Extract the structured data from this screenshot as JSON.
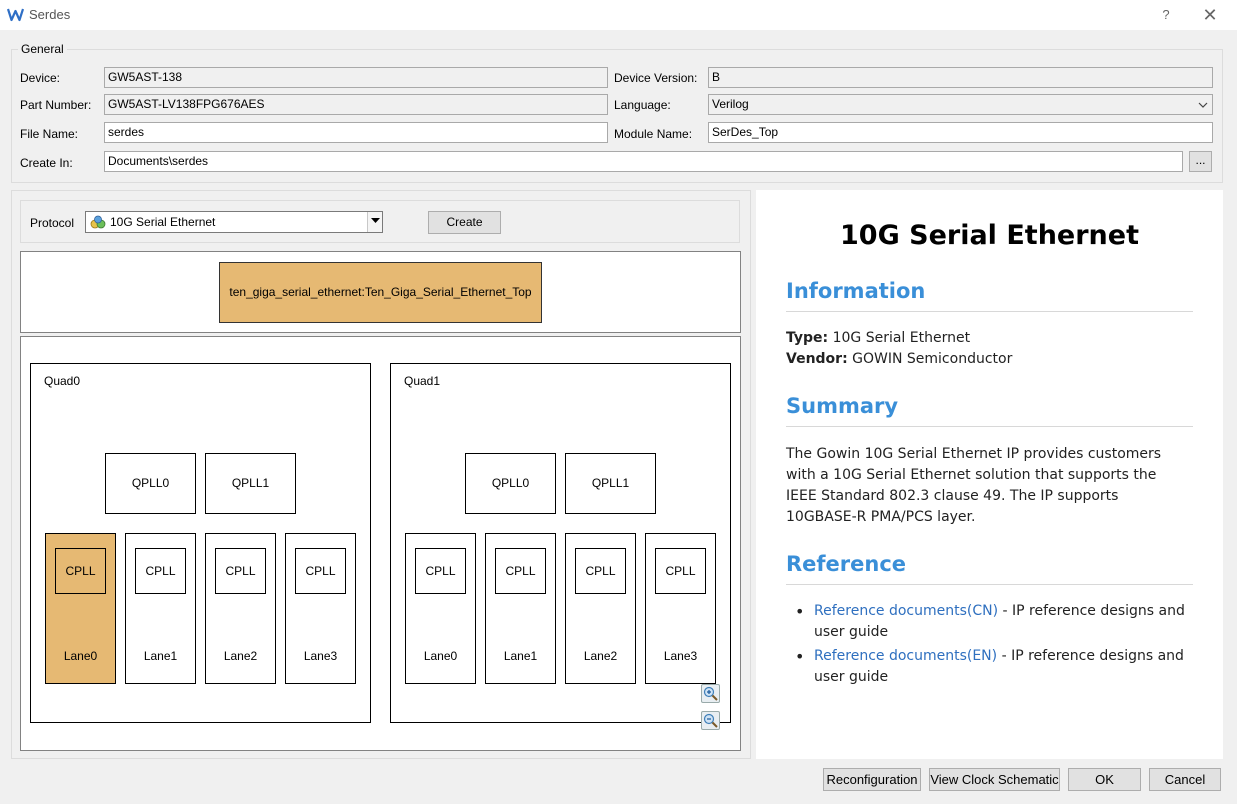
{
  "window": {
    "title": "Serdes",
    "help": "?",
    "close": "✕"
  },
  "general": {
    "group_title": "General",
    "device_label": "Device:",
    "device_value": "GW5AST-138",
    "device_version_label": "Device Version:",
    "device_version_value": "B",
    "part_number_label": "Part Number:",
    "part_number_value": "GW5AST-LV138FPG676AES",
    "language_label": "Language:",
    "language_value": "Verilog",
    "file_name_label": "File Name:",
    "file_name_value": "serdes",
    "module_name_label": "Module Name:",
    "module_name_value": "SerDes_Top",
    "create_in_label": "Create In:",
    "create_in_value": "Documents\\serdes",
    "browse_label": "..."
  },
  "protocol": {
    "label": "Protocol",
    "value": "10G Serial Ethernet",
    "create_label": "Create"
  },
  "top_module": "ten_giga_serial_ethernet:Ten_Giga_Serial_Ethernet_Top",
  "quads": [
    {
      "title": "Quad0",
      "qplls": [
        "QPLL0",
        "QPLL1"
      ],
      "lanes": [
        {
          "cpll": "CPLL",
          "label": "Lane0"
        },
        {
          "cpll": "CPLL",
          "label": "Lane1"
        },
        {
          "cpll": "CPLL",
          "label": "Lane2"
        },
        {
          "cpll": "CPLL",
          "label": "Lane3"
        }
      ]
    },
    {
      "title": "Quad1",
      "qplls": [
        "QPLL0",
        "QPLL1"
      ],
      "lanes": [
        {
          "cpll": "CPLL",
          "label": "Lane0"
        },
        {
          "cpll": "CPLL",
          "label": "Lane1"
        },
        {
          "cpll": "CPLL",
          "label": "Lane2"
        },
        {
          "cpll": "CPLL",
          "label": "Lane3"
        }
      ]
    }
  ],
  "help": {
    "title": "10G Serial Ethernet",
    "info_heading": "Information",
    "type_label": "Type:",
    "type_value": "10G Serial Ethernet",
    "vendor_label": "Vendor:",
    "vendor_value": "GOWIN Semiconductor",
    "summary_heading": "Summary",
    "summary_lines": [
      "The Gowin 10G Serial Ethernet IP provides customers",
      "with a 10G Serial Ethernet solution that supports the",
      "IEEE Standard 802.3 clause 49. The IP supports",
      "10GBASE-R PMA/PCS layer."
    ],
    "reference_heading": "Reference",
    "refs": [
      {
        "link": "Reference documents(CN)",
        "desc1": " - IP reference designs and",
        "desc2": "user guide"
      },
      {
        "link": "Reference documents(EN)",
        "desc1": " - IP reference designs and",
        "desc2": "user guide"
      }
    ]
  },
  "buttons": {
    "reconfiguration": "Reconfiguration",
    "view_clock": "View Clock Schematic",
    "ok": "OK",
    "cancel": "Cancel"
  },
  "colors": {
    "accent_heading": "#3a8fd8",
    "module_fill": "#e6b973",
    "link": "#2e6fbf"
  }
}
